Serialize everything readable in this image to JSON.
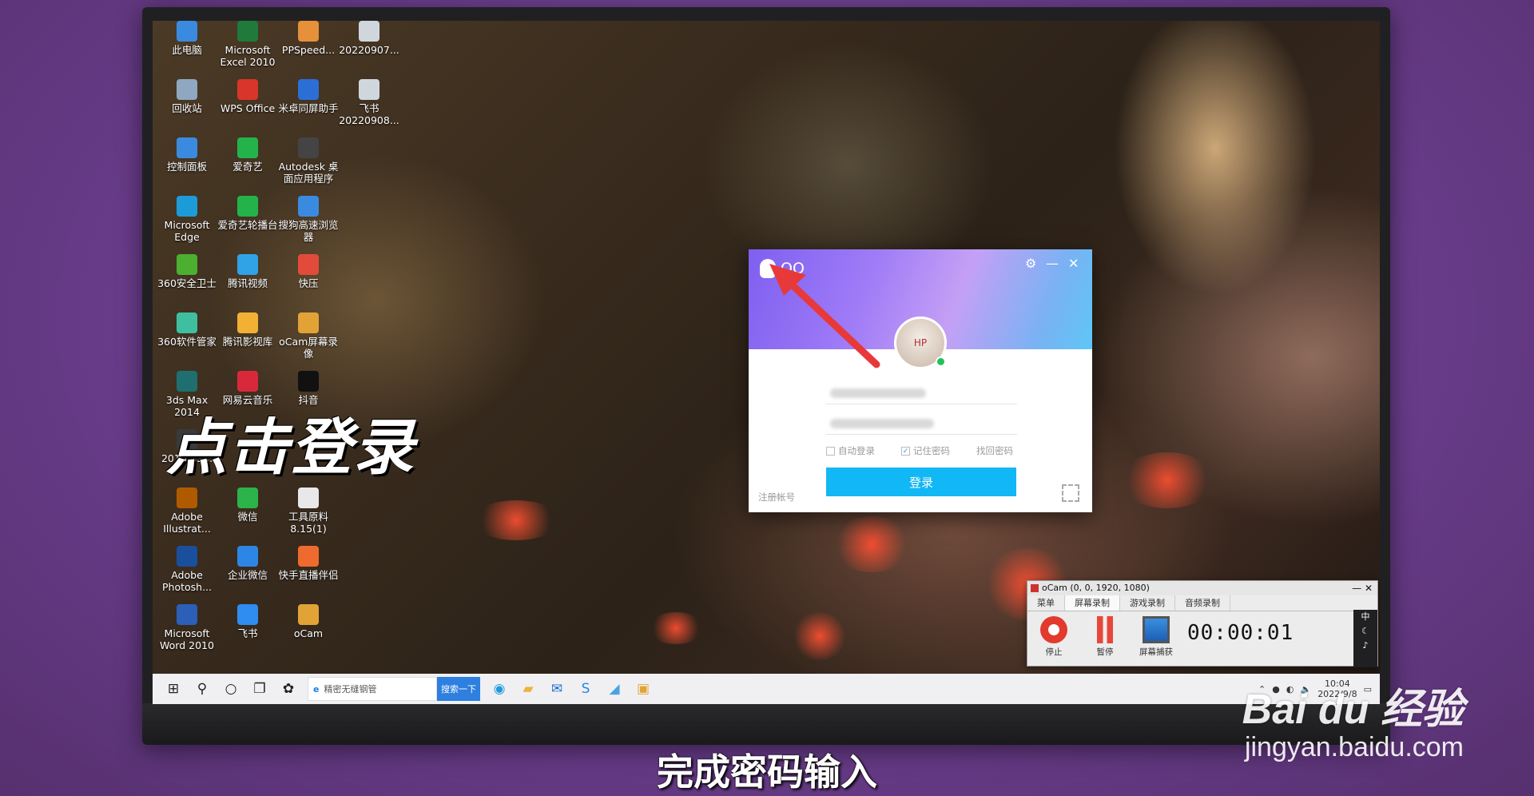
{
  "overlay": {
    "click_text": "点击登录",
    "caption": "完成密码输入"
  },
  "watermark": {
    "brand": "Bai du 经验",
    "url": "jingyan.baidu.com"
  },
  "desktop_icons": [
    {
      "label": "此电脑",
      "color": "#3a8be0"
    },
    {
      "label": "Microsoft Excel 2010",
      "color": "#1f7a3b"
    },
    {
      "label": "PPSpeed...",
      "color": "#e6903a"
    },
    {
      "label": "20220907...",
      "color": "#cfd6dc"
    },
    {
      "label": "回收站",
      "color": "#8fa7c0"
    },
    {
      "label": "WPS Office",
      "color": "#d9352b"
    },
    {
      "label": "米卓同屏助手",
      "color": "#2b6fd6"
    },
    {
      "label": "飞书 20220908...",
      "color": "#cfd6dc"
    },
    {
      "label": "控制面板",
      "color": "#3a8be0"
    },
    {
      "label": "爱奇艺",
      "color": "#24b34a"
    },
    {
      "label": "Autodesk 桌面应用程序",
      "color": "#444444"
    },
    {
      "label": "Microsoft Edge",
      "color": "#1d9bd9"
    },
    {
      "label": "爱奇艺轮播台",
      "color": "#24b34a"
    },
    {
      "label": "搜狗高速浏览器",
      "color": "#3a8be0"
    },
    {
      "label": "360安全卫士",
      "color": "#4caf30"
    },
    {
      "label": "腾讯视频",
      "color": "#2fa3e6"
    },
    {
      "label": "快压",
      "color": "#e24b3a"
    },
    {
      "label": "360软件管家",
      "color": "#3ec0a0"
    },
    {
      "label": "腾讯影视库",
      "color": "#f2b134"
    },
    {
      "label": "oCam屏幕录像",
      "color": "#e2a336"
    },
    {
      "label": "3ds Max 2014",
      "color": "#1f6f70"
    },
    {
      "label": "网易云音乐",
      "color": "#d8293a"
    },
    {
      "label": "抖音",
      "color": "#111111"
    },
    {
      "label": "2016 - S...",
      "color": "#3a3a3a"
    },
    {
      "label": "Adobe Illustrat...",
      "color": "#b05a00"
    },
    {
      "label": "微信",
      "color": "#2cb34a"
    },
    {
      "label": "工具原料 8.15(1)",
      "color": "#e8e8e8"
    },
    {
      "label": "Adobe Photosh...",
      "color": "#1a4f9c"
    },
    {
      "label": "企业微信",
      "color": "#2d86e6"
    },
    {
      "label": "快手直播伴侣",
      "color": "#ef6a2e"
    },
    {
      "label": "Microsoft Word 2010",
      "color": "#2b5fb8"
    },
    {
      "label": "飞书",
      "color": "#2f8cf0"
    },
    {
      "label": "oCam",
      "color": "#e2a336"
    }
  ],
  "qq": {
    "title": "QQ",
    "avatar_text": "HP",
    "auto_login": "自动登录",
    "remember_password": "记住密码",
    "recover_password": "找回密码",
    "login_button": "登录",
    "register": "注册帐号"
  },
  "taskbar": {
    "search_text": "精密无缝钢管",
    "search_button": "搜索一下",
    "clock_time": "10:04",
    "clock_date": "2022/9/8"
  },
  "ocam": {
    "title": "oCam (0, 0, 1920, 1080)",
    "tabs": [
      "菜单",
      "屏幕录制",
      "游戏录制",
      "音频录制"
    ],
    "stop": "停止",
    "pause": "暂停",
    "capture": "屏幕捕获",
    "timer": "00:00:01",
    "ime": "中"
  },
  "colors": {
    "qq_button": "#12b7f5",
    "arrow": "#e8393a",
    "background": "#6b3f8f"
  }
}
